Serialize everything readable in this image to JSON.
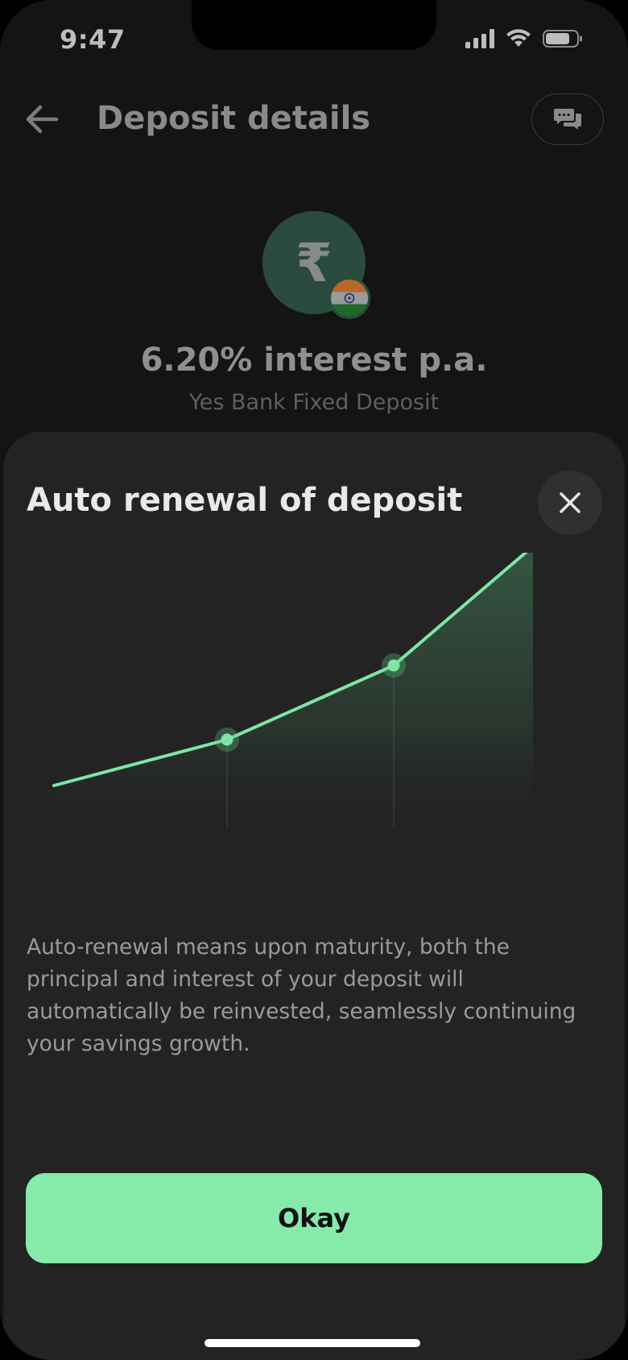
{
  "status_bar": {
    "time": "9:47"
  },
  "header": {
    "title": "Deposit details",
    "back_icon": "arrow-left-icon",
    "chat_icon": "chat-bubbles-icon"
  },
  "deposit": {
    "currency_symbol": "₹",
    "flag_icon": "india-flag-icon",
    "interest": "6.20% interest p.a.",
    "bank": "Yes Bank Fixed Deposit"
  },
  "sheet": {
    "title": "Auto renewal of deposit",
    "close_icon": "close-icon",
    "description": "Auto-renewal means upon maturity, both the principal and interest of your deposit will automatically be reinvested, seamlessly continuing your savings growth.",
    "button_label": "Okay"
  },
  "colors": {
    "accent": "#85eaaa",
    "line": "#7ee5a4",
    "sheet_bg": "#232323"
  }
}
